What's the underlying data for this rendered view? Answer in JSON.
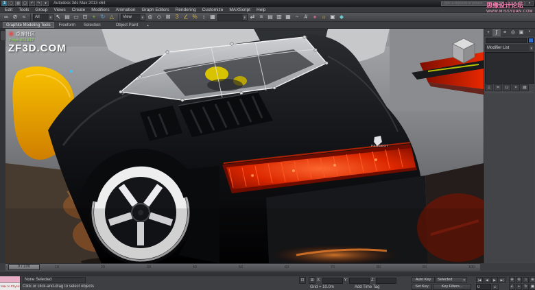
{
  "colors": {
    "chrome_bg": "#3f4043",
    "titlebar_bg": "#1d1e21",
    "viewport_top": "#a7a9ac",
    "viewport_bottom": "#46474a",
    "car_black": "#0a0b0d",
    "accent_orange": "#f0a400",
    "led_red": "#e02800",
    "wedge_red": "#cc1e00",
    "wheel_white": "#eeeeef",
    "watermark_pink": "#ff7fb5",
    "stats_green": "#8be34a",
    "object_color_swatch": "#2f6fd0"
  },
  "window": {
    "title": "Autodesk 3ds Max 2013 x64",
    "search_placeholder": "Type a keyword or phrase",
    "minimize": "─",
    "maximize": "☐",
    "close": "×"
  },
  "quick_access": [
    {
      "n": "app-button",
      "g": "3"
    },
    {
      "n": "new-scene-button",
      "g": "▢"
    },
    {
      "n": "open-file-button",
      "g": "▧"
    },
    {
      "n": "save-file-button",
      "g": "◫"
    },
    {
      "n": "undo-button",
      "g": "↶"
    },
    {
      "n": "redo-button",
      "g": "↷"
    },
    {
      "n": "project-folder-button",
      "g": "▾"
    }
  ],
  "menus": [
    "Edit",
    "Tools",
    "Group",
    "Views",
    "Create",
    "Modifiers",
    "Animation",
    "Graph Editors",
    "Rendering",
    "Customize",
    "MAXScript",
    "Help"
  ],
  "toolbar": {
    "group1": [
      {
        "n": "select-and-link-button",
        "g": "∞"
      },
      {
        "n": "unlink-selection-button",
        "g": "⊘"
      },
      {
        "n": "bind-to-space-warp-button",
        "g": "≈"
      }
    ],
    "selection_filter": {
      "label": "All",
      "arrow": "▼"
    },
    "group2": [
      {
        "n": "select-object-button",
        "g": "↖",
        "c": "#eaeaec"
      },
      {
        "n": "select-by-name-button",
        "g": "▤"
      },
      {
        "n": "selection-region-button",
        "g": "▭"
      },
      {
        "n": "window-crossing-button",
        "g": "⊡"
      },
      {
        "n": "select-and-move-button",
        "g": "+",
        "c": "#7fc24f"
      },
      {
        "n": "select-and-rotate-button",
        "g": "↻",
        "c": "#58a8e0"
      },
      {
        "n": "select-and-scale-button",
        "g": "△",
        "c": "#d8c050"
      }
    ],
    "reference_coordinate": {
      "label": "View",
      "arrow": "▼"
    },
    "group3": [
      {
        "n": "use-pivot-center-button",
        "g": "◎"
      },
      {
        "n": "select-and-manipulate-button",
        "g": "◇"
      },
      {
        "n": "keyboard-override-button",
        "g": "⊠"
      },
      {
        "n": "snaps-toggle-button",
        "g": "3",
        "c": "#d8b84a"
      },
      {
        "n": "angle-snap-button",
        "g": "∠",
        "c": "#d8b84a"
      },
      {
        "n": "percent-snap-button",
        "g": "%",
        "c": "#d8b84a"
      },
      {
        "n": "spinner-snap-button",
        "g": "↕"
      },
      {
        "n": "edit-named-sets-button",
        "g": "▦"
      }
    ],
    "named_sets": {
      "label": "",
      "arrow": "▼"
    },
    "group4": [
      {
        "n": "mirror-button",
        "g": "⇄"
      },
      {
        "n": "align-button",
        "g": "≡"
      },
      {
        "n": "scene-explorer-button",
        "g": "▤"
      },
      {
        "n": "layer-manager-button",
        "g": "▥"
      },
      {
        "n": "ribbon-toggle-button",
        "g": "▦"
      },
      {
        "n": "curve-editor-button",
        "g": "~"
      },
      {
        "n": "schematic-view-button",
        "g": "#"
      },
      {
        "n": "material-editor-button",
        "g": "●",
        "c": "#cc6688"
      },
      {
        "n": "render-setup-button",
        "g": "☼",
        "c": "#e0b84a"
      },
      {
        "n": "rendered-frame-button",
        "g": "▣"
      },
      {
        "n": "render-production-button",
        "g": "◆",
        "c": "#6ac8c8"
      }
    ]
  },
  "ribbon": {
    "tabs": [
      "Graphite Modeling Tools",
      "Freeform",
      "Selection"
    ],
    "extra_tab": "Object Paint",
    "collapse_arrow": "▴"
  },
  "viewport": {
    "stats_line": "Polys: 851,617",
    "zf_seal": "卓峰社区",
    "zf_title": "ZF3D.COM",
    "my_line1": "思缘设计论坛",
    "my_line2": "WWW.MISSYUAN.COM",
    "badge_text": "PEUGEOT"
  },
  "command_panel": {
    "tabs": [
      {
        "n": "create-tab",
        "g": "+"
      },
      {
        "n": "modify-tab",
        "g": "∫"
      },
      {
        "n": "hierarchy-tab",
        "g": "≡"
      },
      {
        "n": "motion-tab",
        "g": "◎"
      },
      {
        "n": "display-tab",
        "g": "▣"
      },
      {
        "n": "utilities-tab",
        "g": "*"
      }
    ],
    "object_name": "",
    "modifier_list_label": "Modifier List",
    "dropdown_arrow": "▼",
    "stack_buttons": [
      {
        "n": "pin-stack-button",
        "g": "⊥"
      },
      {
        "n": "show-end-result-button",
        "g": "≍"
      },
      {
        "n": "make-unique-button",
        "g": "⊔"
      },
      {
        "n": "remove-modifier-button",
        "g": "×"
      },
      {
        "n": "configure-modifier-sets-button",
        "g": "▤"
      }
    ]
  },
  "timeline": {
    "slider_label": "0 / 100",
    "labels": [
      "0",
      "10",
      "20",
      "30",
      "40",
      "50",
      "60",
      "70",
      "80",
      "90",
      "100"
    ]
  },
  "status": {
    "listener_text": "Max to Physics On",
    "selection_status": "None Selected",
    "prompt": "Click or click-and-drag to select objects",
    "lock_glyph": "⊡",
    "abs_glyph": "⊞",
    "coords": {
      "x_label": "X:",
      "y_label": "Y:",
      "z_label": "Z:",
      "x": "",
      "y": "",
      "z": ""
    },
    "grid": "Grid = 10.0m",
    "add_time_tag": "Add Time Tag",
    "anim": {
      "auto_key": "Auto Key",
      "set_key": "Set Key",
      "key_mode": "Selected",
      "mode_arrow": "▼",
      "key_filters": "Key Filters..."
    },
    "frame_value": "0",
    "time_config_glyph": "▸",
    "playback": [
      {
        "n": "go-to-start-button",
        "g": "|◀"
      },
      {
        "n": "previous-frame-button",
        "g": "◀"
      },
      {
        "n": "play-animation-button",
        "g": "▶"
      },
      {
        "n": "go-to-end-button",
        "g": "▶|"
      }
    ],
    "nav": [
      {
        "n": "zoom-button",
        "g": "⊕"
      },
      {
        "n": "zoom-all-button",
        "g": "⊚"
      },
      {
        "n": "zoom-extents-button",
        "g": "⌂"
      },
      {
        "n": "zoom-extents-all-button",
        "g": "⊞"
      },
      {
        "n": "field-of-view-button",
        "g": "∠"
      },
      {
        "n": "pan-view-button",
        "g": "+"
      },
      {
        "n": "orbit-view-button",
        "g": "↻"
      },
      {
        "n": "maximize-viewport-button",
        "g": "▣"
      }
    ]
  }
}
